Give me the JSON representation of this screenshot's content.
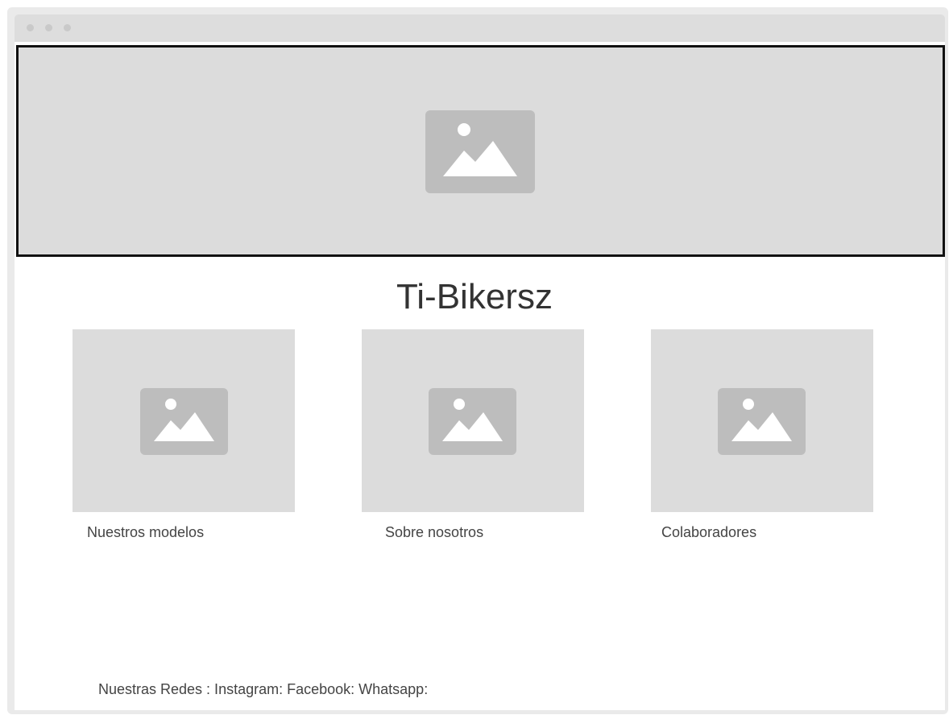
{
  "window": {
    "controls": [
      "dot",
      "dot",
      "dot"
    ]
  },
  "hero": {
    "image": "image-placeholder-icon"
  },
  "site": {
    "title": "Ti-Bikersz"
  },
  "cards": [
    {
      "label": "Nuestros modelos",
      "image": "image-placeholder-icon"
    },
    {
      "label": "Sobre nosotros",
      "image": "image-placeholder-icon"
    },
    {
      "label": "Colaboradores",
      "image": "image-placeholder-icon"
    }
  ],
  "footer": {
    "text": "Nuestras Redes : Instagram: Facebook: Whatsapp:"
  },
  "colors": {
    "placeholder_bg": "#dcdcdc",
    "placeholder_icon": "#bdbdbd",
    "hero_border": "#111111"
  }
}
